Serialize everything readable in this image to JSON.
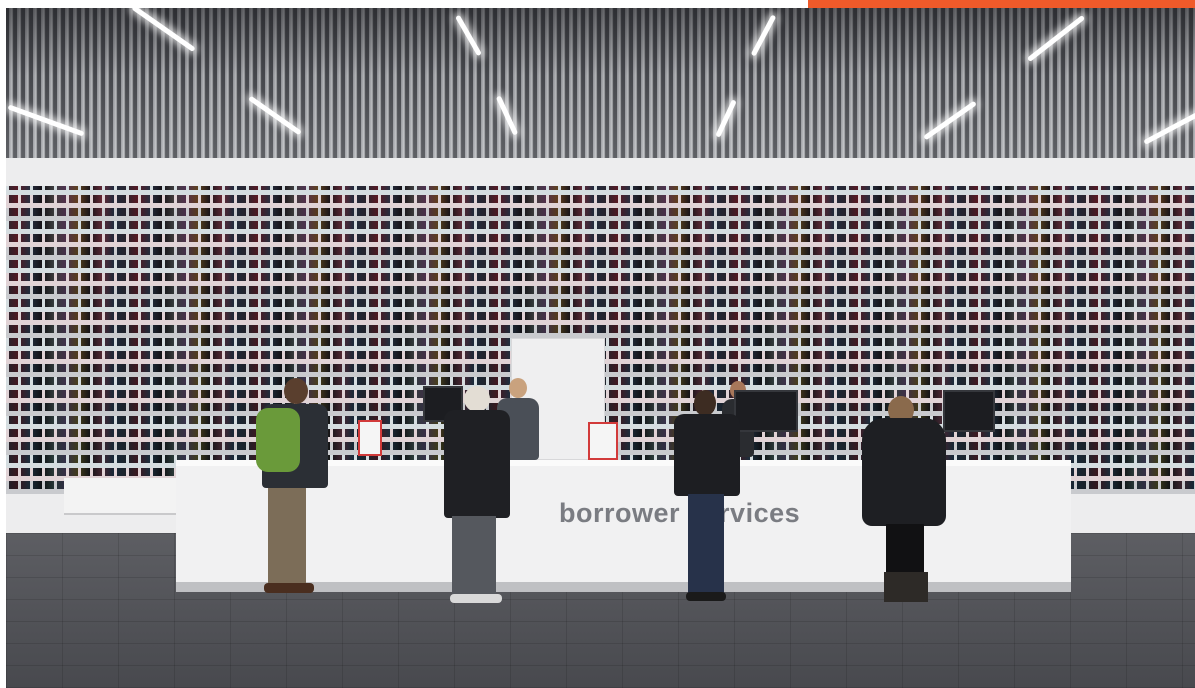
{
  "scene": {
    "counter_sign": "borrower services",
    "accent_color": "#f05a2a",
    "palette": {
      "ceiling": "#2f3136",
      "wall": "#ededee",
      "floor": "#4e4f54",
      "counter": "#f1f1f2",
      "sign_text": "#7a7c82"
    }
  }
}
